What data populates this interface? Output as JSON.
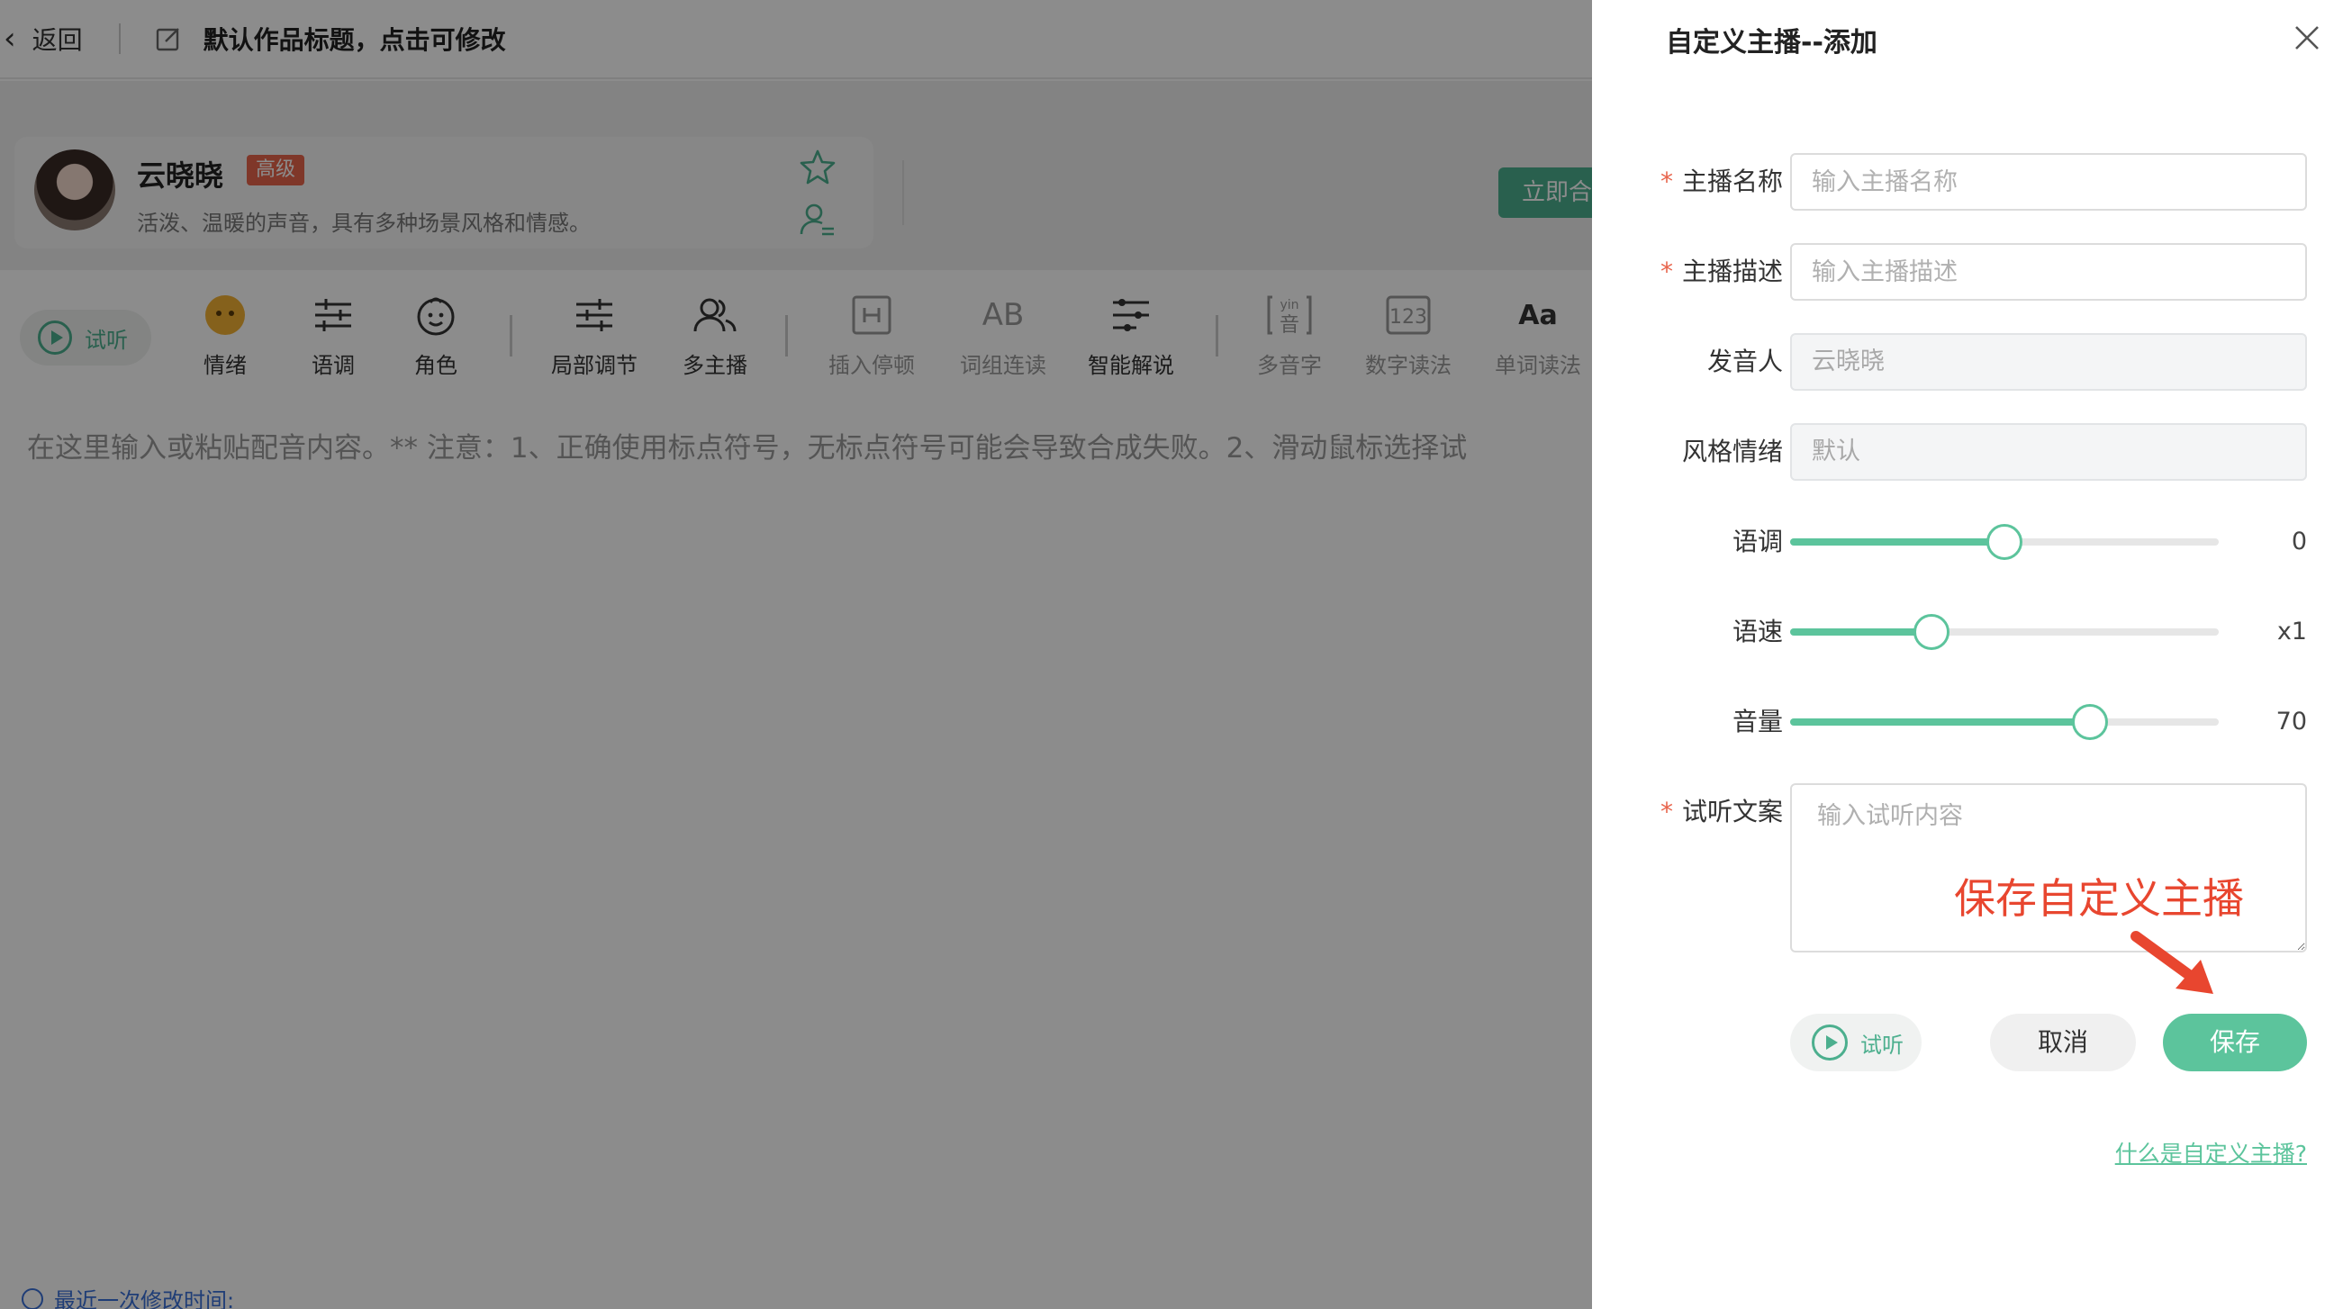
{
  "topbar": {
    "back_label": "返回",
    "title": "默认作品标题，点击可修改"
  },
  "voice": {
    "name": "云晓晓",
    "level": "高级",
    "description": "活泼、温暖的声音，具有多种场景风格和情感。"
  },
  "synth_button": "立即合",
  "toolbar": {
    "listen": "试听",
    "tools": [
      {
        "label": "情绪",
        "icon": "emoji-face-icon"
      },
      {
        "label": "语调",
        "icon": "sliders-icon"
      },
      {
        "label": "角色",
        "icon": "child-face-icon"
      },
      {
        "label": "局部调节",
        "icon": "sliders-icon"
      },
      {
        "label": "多主播",
        "icon": "users-icon"
      },
      {
        "label": "插入停顿",
        "icon": "pause-box-icon"
      },
      {
        "label": "词组连读",
        "icon": "ab-icon"
      },
      {
        "label": "智能解说",
        "icon": "list-sliders-icon"
      },
      {
        "label": "多音字",
        "icon": "pinyin-icon"
      },
      {
        "label": "数字读法",
        "icon": "number-icon"
      },
      {
        "label": "单词读法",
        "icon": "aa-icon"
      }
    ]
  },
  "editor": {
    "placeholder": "在这里输入或粘贴配音内容。** 注意：1、正确使用标点符号，无标点符号可能会导致合成失败。2、滑动鼠标选择试",
    "last_modified": "最近一次修改时间:"
  },
  "drawer": {
    "title": "自定义主播--添加",
    "fields": {
      "name": {
        "label": "主播名称",
        "required": true,
        "placeholder": "输入主播名称",
        "value": ""
      },
      "desc": {
        "label": "主播描述",
        "required": true,
        "placeholder": "输入主播描述",
        "value": ""
      },
      "speaker": {
        "label": "发音人",
        "value": "云晓晓"
      },
      "style": {
        "label": "风格情绪",
        "value": "默认"
      },
      "pitch": {
        "label": "语调",
        "value": "0",
        "fill_fraction": 0.5
      },
      "speed": {
        "label": "语速",
        "value": "x1",
        "fill_fraction": 0.33
      },
      "volume": {
        "label": "音量",
        "value": "70",
        "fill_fraction": 0.7
      },
      "sample": {
        "label": "试听文案",
        "required": true,
        "placeholder": "输入试听内容"
      }
    },
    "required_mark": "*",
    "annotation": "保存自定义主播",
    "buttons": {
      "listen": "试听",
      "cancel": "取消",
      "save": "保存"
    },
    "help_link": "什么是自定义主播?"
  },
  "colors": {
    "accent": "#5cc49c",
    "accent_dark": "#4caf8e",
    "required": "#e8644c",
    "annotation": "#e8462f",
    "link": "#3a6fd8"
  }
}
